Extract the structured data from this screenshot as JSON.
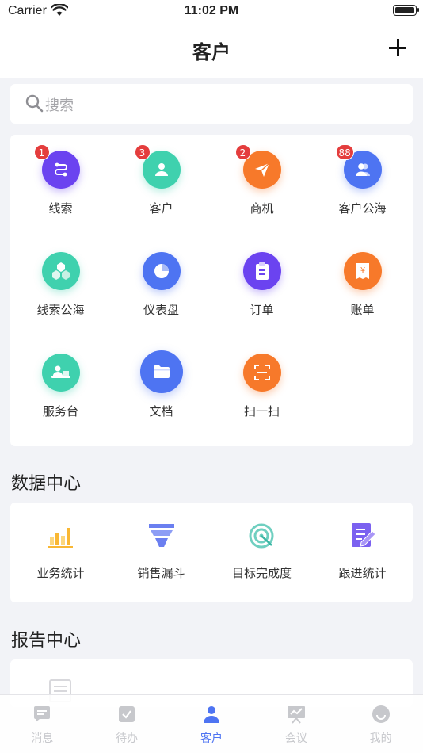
{
  "status": {
    "carrier": "Carrier",
    "time": "11:02 PM"
  },
  "nav": {
    "title": "客户"
  },
  "search": {
    "placeholder": "搜索"
  },
  "menu": [
    {
      "label": "线索",
      "badge": "1",
      "color": "#6b43f0",
      "icon": "lead-icon"
    },
    {
      "label": "客户",
      "badge": "3",
      "color": "#3fd1ae",
      "icon": "customer-icon"
    },
    {
      "label": "商机",
      "badge": "2",
      "color": "#f7792a",
      "icon": "paper-plane-icon"
    },
    {
      "label": "客户公海",
      "badge": "88",
      "color": "#4e74f2",
      "icon": "customer-pool-icon"
    },
    {
      "label": "线索公海",
      "color": "#3fd1ae",
      "icon": "cubes-icon"
    },
    {
      "label": "仪表盘",
      "color": "#4e74f2",
      "icon": "pie-chart-icon"
    },
    {
      "label": "订单",
      "color": "#6b43f0",
      "icon": "clipboard-icon"
    },
    {
      "label": "账单",
      "color": "#f7792a",
      "icon": "receipt-icon"
    },
    {
      "label": "服务台",
      "color": "#3fd1ae",
      "icon": "service-desk-icon"
    },
    {
      "label": "文档",
      "color": "#4e74f2",
      "icon": "folder-icon"
    },
    {
      "label": "扫一扫",
      "color": "#f7792a",
      "icon": "scan-icon"
    }
  ],
  "data_center": {
    "title": "数据中心",
    "items": [
      {
        "label": "业务统计",
        "icon": "bar-chart-icon"
      },
      {
        "label": "销售漏斗",
        "icon": "funnel-icon"
      },
      {
        "label": "目标完成度",
        "icon": "target-icon"
      },
      {
        "label": "跟进统计",
        "icon": "note-edit-icon"
      }
    ]
  },
  "report_center": {
    "title": "报告中心"
  },
  "tabs": [
    {
      "label": "消息",
      "icon": "message-icon"
    },
    {
      "label": "待办",
      "icon": "todo-icon"
    },
    {
      "label": "客户",
      "icon": "person-icon",
      "active": true
    },
    {
      "label": "会议",
      "icon": "meeting-icon"
    },
    {
      "label": "我的",
      "icon": "profile-icon"
    }
  ],
  "colors": {
    "accent": "#4e74f2",
    "badge": "#e43d3d"
  }
}
